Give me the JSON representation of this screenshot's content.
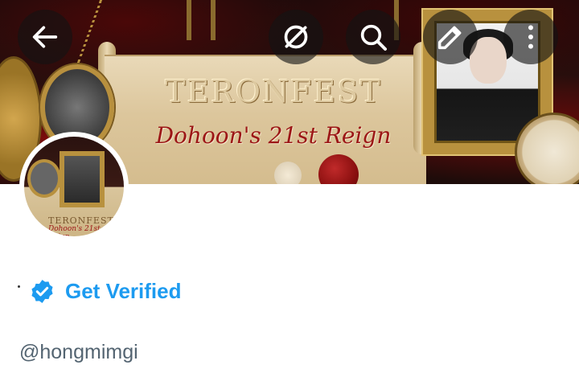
{
  "banner": {
    "title": "TERONFEST",
    "subtitle": "Dohoon's 21st Reign",
    "avatar_title": "TERONFEST",
    "avatar_subtitle": "Dohoon's 21st Reign"
  },
  "header": {
    "icons": [
      "back-arrow-icon",
      "grok-icon",
      "search-icon",
      "edit-icon",
      "more-vertical-icon"
    ]
  },
  "profile": {
    "get_verified_label": "Get Verified",
    "handle": "@hongmimgi"
  },
  "colors": {
    "accent": "#1d9bf0",
    "secondary_text": "#536471",
    "button_overlay": "rgba(20,20,20,0.62)"
  }
}
